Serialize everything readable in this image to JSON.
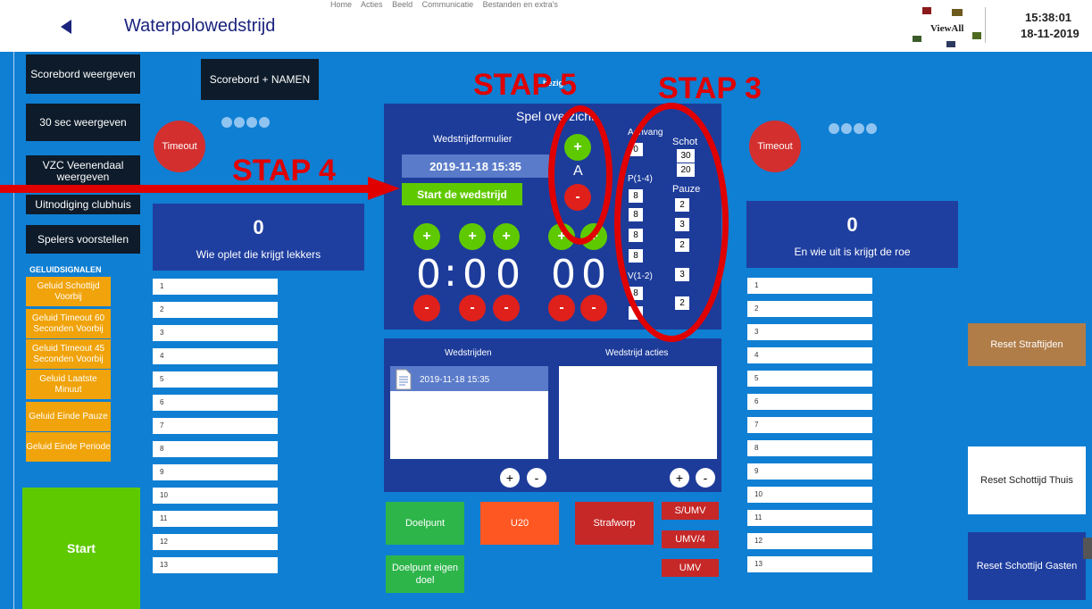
{
  "header": {
    "title": "Waterpolowedstrijd",
    "toolbar": [
      "Home",
      "Acties",
      "Beeld",
      "Communicatie",
      "Bestanden en extra's"
    ],
    "viewall": "ViewAll",
    "time": "15:38:01",
    "date": "18-11-2019"
  },
  "left_buttons": {
    "scorebord": "Scorebord weergeven",
    "scorebord_namen": "Scorebord + NAMEN",
    "sec30": "30 sec weergeven",
    "vzc": "VZC Veenendaal weergeven",
    "uitnodiging": "Uitnodiging clubhuis",
    "spelers": "Spelers voorstellen"
  },
  "geluid": {
    "title": "GELUIDSIGNALEN",
    "items": [
      "Geluid Schottijd Voorbij",
      "Geluid Timeout 60 Seconden Voorbij",
      "Geluid Timeout 45 Seconden Voorbij",
      "Geluid Laatste Minuut",
      "Geluid Einde Pauze",
      "Geluid Einde Periode"
    ]
  },
  "start_label": "Start",
  "timeout_label": "Timeout",
  "home": {
    "score": "0",
    "slogan": "Wie oplet die krijgt lekkers",
    "players": [
      "1",
      "2",
      "3",
      "4",
      "5",
      "6",
      "7",
      "8",
      "9",
      "10",
      "11",
      "12",
      "13"
    ]
  },
  "guest": {
    "score": "0",
    "slogan": "En wie uit is krijgt de roe",
    "players": [
      "1",
      "2",
      "3",
      "4",
      "5",
      "6",
      "7",
      "8",
      "9",
      "10",
      "11",
      "12",
      "13"
    ]
  },
  "center": {
    "spel": "Spel overzicht",
    "wedstrijdformulier": "Wedstrijdformulier",
    "datetime": "2019-11-18   15:35",
    "start_wedstrijd": "Start de wedstrijd",
    "bezig": "bezig",
    "letter": "A",
    "clock": [
      "0",
      ":",
      "0",
      "0"
    ],
    "score_digits": [
      "0",
      "0"
    ],
    "aanvang_label": "Aanvang",
    "aanvang_value": "0",
    "p_label": "P(1-4)",
    "p_values": [
      "8",
      "8",
      "8",
      "8"
    ],
    "v_label": "V(1-2)",
    "v_values": [
      "8"
    ],
    "schot_label": "Schot",
    "schot_values": [
      "30",
      "20"
    ],
    "pauze_label": "Pauze",
    "pauze_values": [
      "2",
      "3",
      "2",
      "3",
      "2"
    ]
  },
  "lists": {
    "wedstrijden": "Wedstrijden",
    "acties": "Wedstrijd acties",
    "match_item": "2019-11-18   15:35"
  },
  "actions": {
    "doelpunt": "Doelpunt",
    "u20": "U20",
    "strafworp": "Strafworp",
    "sumv": "S/UMV",
    "umv4": "UMV/4",
    "umv": "UMV",
    "eigen": "Doelpunt eigen doel"
  },
  "right_buttons": {
    "reset_straf": "Reset Straftijden",
    "reset_thuis": "Reset Schottijd Thuis",
    "reset_gasten": "Reset Schottijd Gasten"
  },
  "annotations": {
    "stap3": "STAP 3",
    "stap4": "STAP 4",
    "stap5": "STAP 5"
  },
  "colors": {
    "background": "#0f7fd3",
    "panel": "#1d3c9a",
    "green": "#5fc900",
    "red": "#e0201a",
    "orange": "#f0a30a",
    "annotation": "#e00000"
  }
}
